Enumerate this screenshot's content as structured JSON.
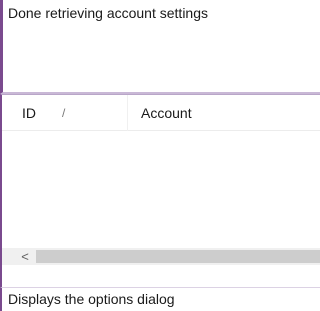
{
  "log": {
    "message": "Done retrieving account settings"
  },
  "list": {
    "columns": [
      {
        "label": "ID",
        "sort_icon": "/"
      },
      {
        "label": "Account"
      }
    ],
    "rows": [],
    "scroll_left_icon": "<"
  },
  "status": {
    "text": "Displays the options dialog"
  }
}
